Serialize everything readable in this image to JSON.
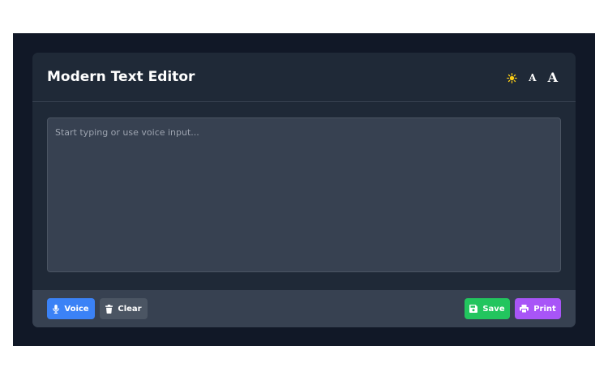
{
  "editor": {
    "title": "Modern Text Editor",
    "text": "",
    "placeholder": "Start typing or use voice input..."
  },
  "header_tools": [
    {
      "name": "theme-toggle",
      "icon": "sun-icon",
      "color": "#facc15"
    },
    {
      "name": "decrease-font-size",
      "label": "A"
    },
    {
      "name": "increase-font-size",
      "label": "A"
    }
  ],
  "toolbar": {
    "voice_label": "Voice",
    "clear_label": "Clear",
    "save_label": "Save",
    "print_label": "Print"
  },
  "colors": {
    "background": "#111827",
    "card": "#1f2937",
    "editor": "#374151",
    "footer": "#374151",
    "voice": "#3b82f6",
    "clear": "#4b5563",
    "save": "#22c55e",
    "print": "#a855f7",
    "accent_sun": "#facc15"
  }
}
